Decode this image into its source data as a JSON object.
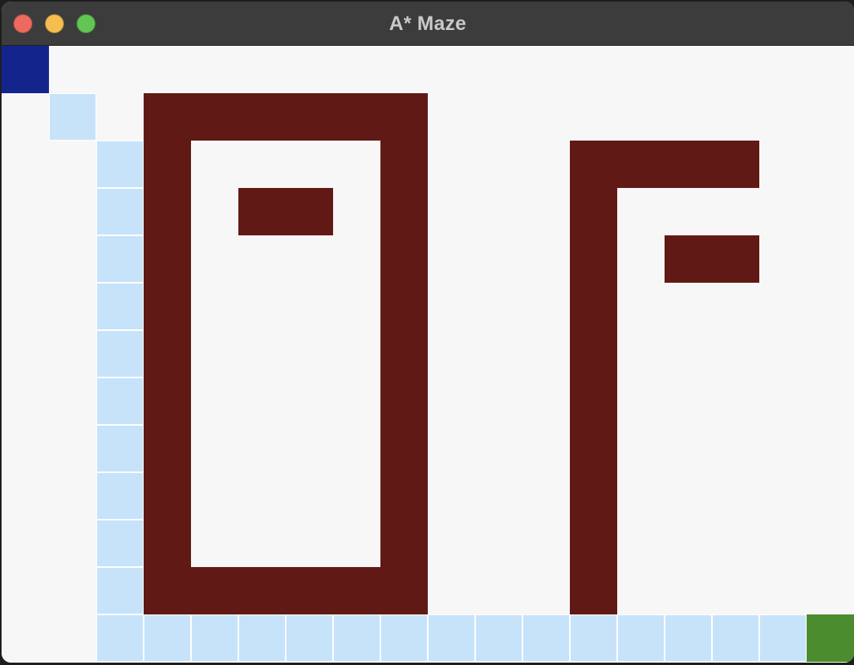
{
  "window": {
    "title": "A* Maze",
    "controls": {
      "close_color": "#ee6a5f",
      "minimize_color": "#f5be4f",
      "zoom_color": "#62c554"
    }
  },
  "maze": {
    "cols": 18,
    "rows": 13,
    "colors": {
      "empty": "#f7f7f7",
      "wall": "#611915",
      "path": "#c7e3fa",
      "start": "#13258c",
      "goal": "#4a8c2e"
    },
    "start": [
      0,
      0
    ],
    "goal": [
      17,
      12
    ],
    "walls": [
      [
        3,
        1
      ],
      [
        4,
        1
      ],
      [
        5,
        1
      ],
      [
        6,
        1
      ],
      [
        7,
        1
      ],
      [
        8,
        1
      ],
      [
        3,
        2
      ],
      [
        8,
        2
      ],
      [
        12,
        2
      ],
      [
        13,
        2
      ],
      [
        14,
        2
      ],
      [
        15,
        2
      ],
      [
        3,
        3
      ],
      [
        5,
        3
      ],
      [
        6,
        3
      ],
      [
        8,
        3
      ],
      [
        12,
        3
      ],
      [
        3,
        4
      ],
      [
        8,
        4
      ],
      [
        12,
        4
      ],
      [
        14,
        4
      ],
      [
        15,
        4
      ],
      [
        3,
        5
      ],
      [
        8,
        5
      ],
      [
        12,
        5
      ],
      [
        3,
        6
      ],
      [
        8,
        6
      ],
      [
        12,
        6
      ],
      [
        3,
        7
      ],
      [
        8,
        7
      ],
      [
        12,
        7
      ],
      [
        3,
        8
      ],
      [
        8,
        8
      ],
      [
        12,
        8
      ],
      [
        3,
        9
      ],
      [
        8,
        9
      ],
      [
        12,
        9
      ],
      [
        3,
        10
      ],
      [
        8,
        10
      ],
      [
        12,
        10
      ],
      [
        3,
        11
      ],
      [
        4,
        11
      ],
      [
        5,
        11
      ],
      [
        6,
        11
      ],
      [
        7,
        11
      ],
      [
        8,
        11
      ],
      [
        12,
        11
      ]
    ],
    "path": [
      [
        1,
        1
      ],
      [
        2,
        2
      ],
      [
        2,
        3
      ],
      [
        2,
        4
      ],
      [
        2,
        5
      ],
      [
        2,
        6
      ],
      [
        2,
        7
      ],
      [
        2,
        8
      ],
      [
        2,
        9
      ],
      [
        2,
        10
      ],
      [
        2,
        11
      ],
      [
        2,
        12
      ],
      [
        3,
        12
      ],
      [
        4,
        12
      ],
      [
        5,
        12
      ],
      [
        6,
        12
      ],
      [
        7,
        12
      ],
      [
        8,
        12
      ],
      [
        9,
        12
      ],
      [
        10,
        12
      ],
      [
        11,
        12
      ],
      [
        12,
        12
      ],
      [
        13,
        12
      ],
      [
        14,
        12
      ],
      [
        15,
        12
      ],
      [
        16,
        12
      ]
    ]
  }
}
